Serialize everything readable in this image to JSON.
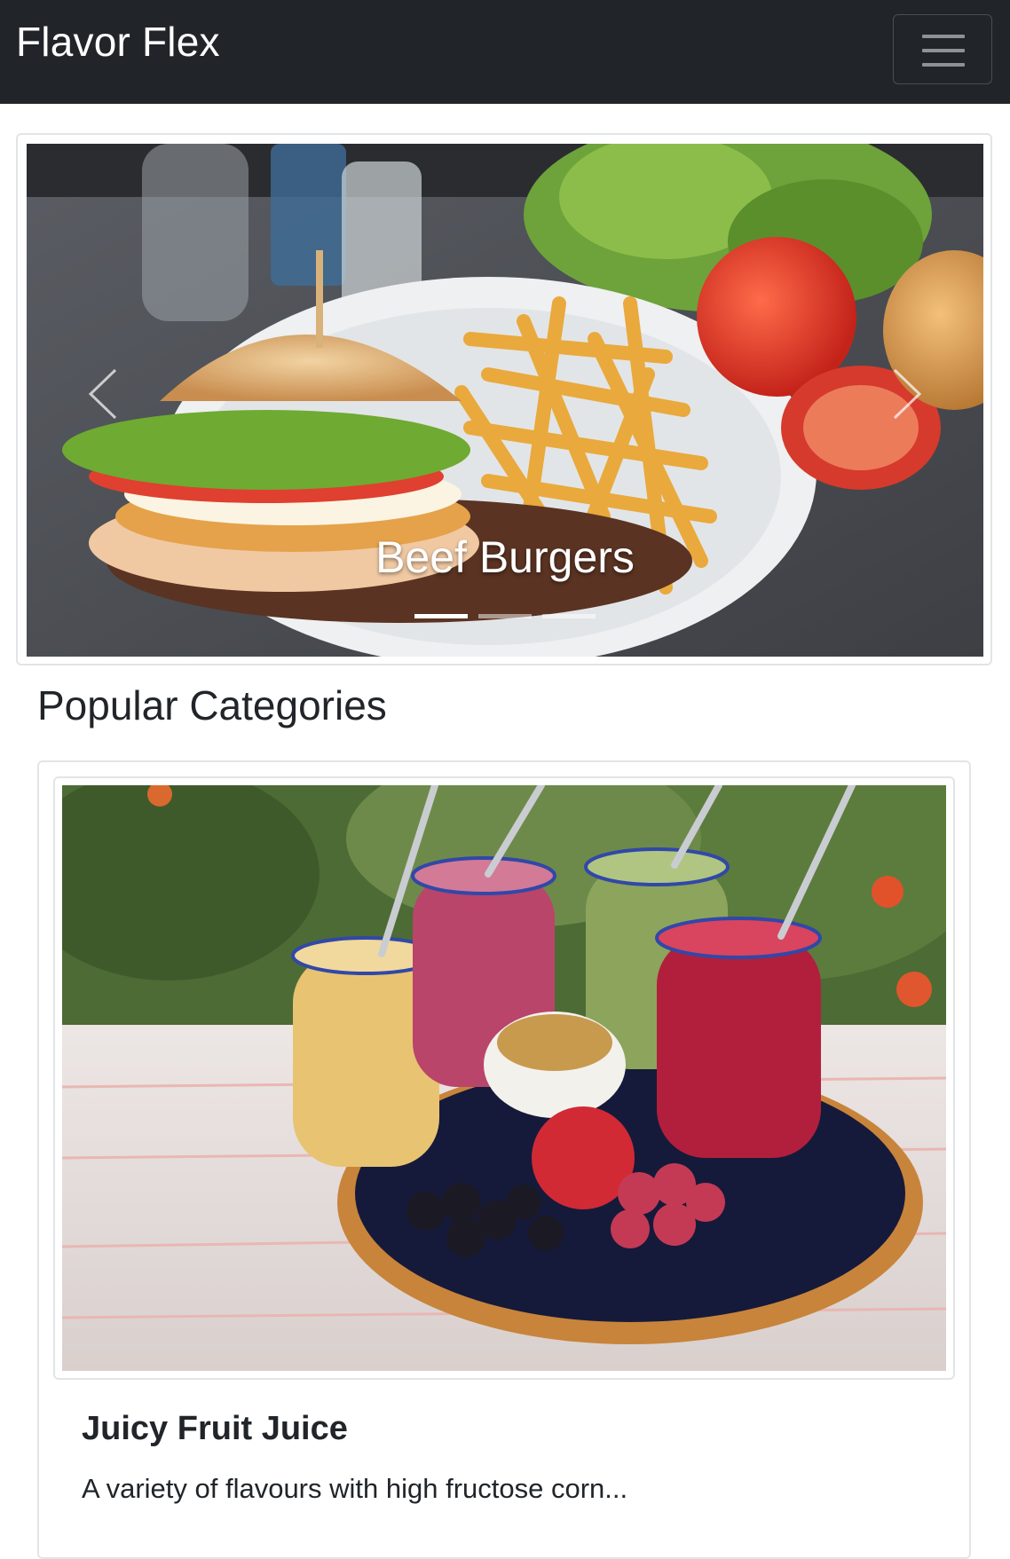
{
  "navbar": {
    "brand": "Flavor Flex",
    "toggle_icon": "hamburger-menu-icon",
    "background": "#212529"
  },
  "carousel": {
    "caption": "Beef Burgers",
    "active_slide": 1,
    "slide_count": 3,
    "prev_icon": "chevron-left-icon",
    "next_icon": "chevron-right-icon"
  },
  "popular": {
    "title": "Popular Categories"
  },
  "category_card": {
    "title": "Juicy Fruit Juice",
    "text": "A variety of flavours with high fructose corn..."
  }
}
